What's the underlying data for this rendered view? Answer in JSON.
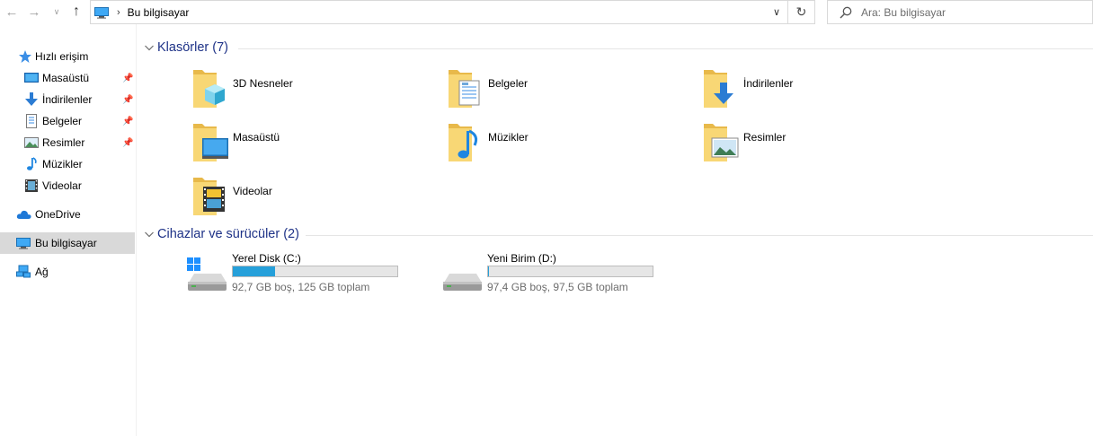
{
  "address_bar": {
    "path_label": "Bu bilgisayar",
    "search_placeholder": "Ara: Bu bilgisayar"
  },
  "sidebar": {
    "items": [
      {
        "label": "Hızlı erişim",
        "icon": "star-icon"
      },
      {
        "label": "Masaüstü",
        "icon": "desktop-icon",
        "pinned": true
      },
      {
        "label": "İndirilenler",
        "icon": "download-icon",
        "pinned": true
      },
      {
        "label": "Belgeler",
        "icon": "document-icon",
        "pinned": true
      },
      {
        "label": "Resimler",
        "icon": "pictures-icon",
        "pinned": true
      },
      {
        "label": "Müzikler",
        "icon": "music-icon"
      },
      {
        "label": "Videolar",
        "icon": "video-icon"
      },
      {
        "label": "OneDrive",
        "icon": "cloud-icon"
      },
      {
        "label": "Bu bilgisayar",
        "icon": "computer-icon",
        "selected": true
      },
      {
        "label": "Ağ",
        "icon": "network-icon"
      }
    ]
  },
  "folders_group": {
    "title": "Klasörler (7)",
    "items": [
      {
        "label": "3D Nesneler",
        "icon": "3d-objects-folder-icon"
      },
      {
        "label": "Belgeler",
        "icon": "documents-folder-icon"
      },
      {
        "label": "İndirilenler",
        "icon": "downloads-folder-icon"
      },
      {
        "label": "Masaüstü",
        "icon": "desktop-folder-icon"
      },
      {
        "label": "Müzikler",
        "icon": "music-folder-icon"
      },
      {
        "label": "Resimler",
        "icon": "pictures-folder-icon"
      },
      {
        "label": "Videolar",
        "icon": "videos-folder-icon"
      }
    ]
  },
  "devices_group": {
    "title": "Cihazlar ve sürücüler (2)",
    "items": [
      {
        "name": "Yerel Disk (C:)",
        "free_text": "92,7 GB boş, 125 GB toplam",
        "used_fraction": 0.258,
        "icon": "system-drive-icon"
      },
      {
        "name": "Yeni Birim (D:)",
        "free_text": "97,4 GB boş, 97,5 GB toplam",
        "used_fraction": 0.001,
        "icon": "drive-icon"
      }
    ]
  },
  "colors": {
    "accent_title": "#1e3287",
    "usage_bar": "#26a0da",
    "folder_yellow": "#f8d775",
    "selected_bg": "#d9d9d9"
  }
}
